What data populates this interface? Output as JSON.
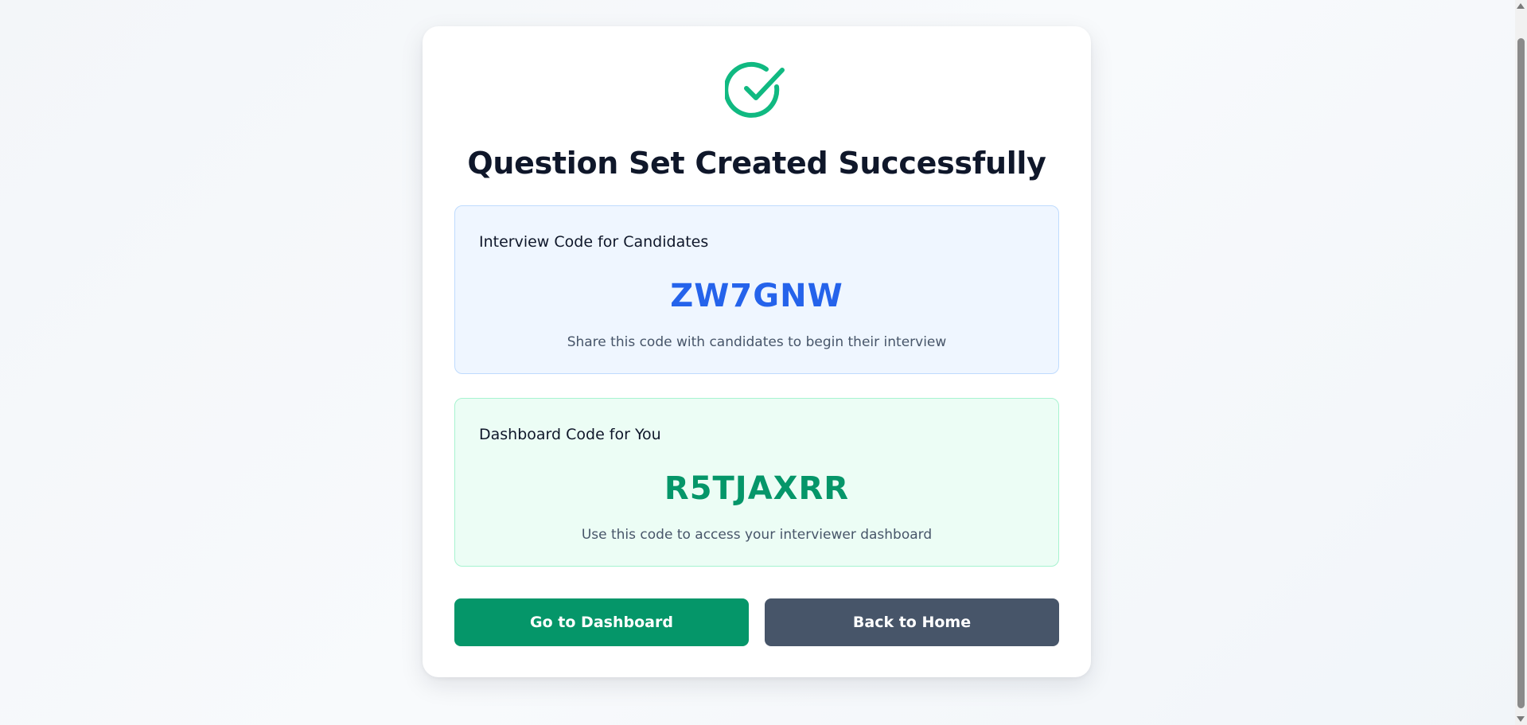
{
  "page": {
    "title": "Question Set Created Successfully",
    "icon": "check-circle-icon",
    "accent_success": "#10b981"
  },
  "interview": {
    "label": "Interview Code for Candidates",
    "code": "ZW7GNW",
    "hint": "Share this code with candidates to begin their interview",
    "color": "#2563eb"
  },
  "dashboard": {
    "label": "Dashboard Code for You",
    "code": "R5TJAXRR",
    "hint": "Use this code to access your interviewer dashboard",
    "color": "#059669"
  },
  "actions": {
    "dashboard_label": "Go to Dashboard",
    "home_label": "Back to Home"
  }
}
